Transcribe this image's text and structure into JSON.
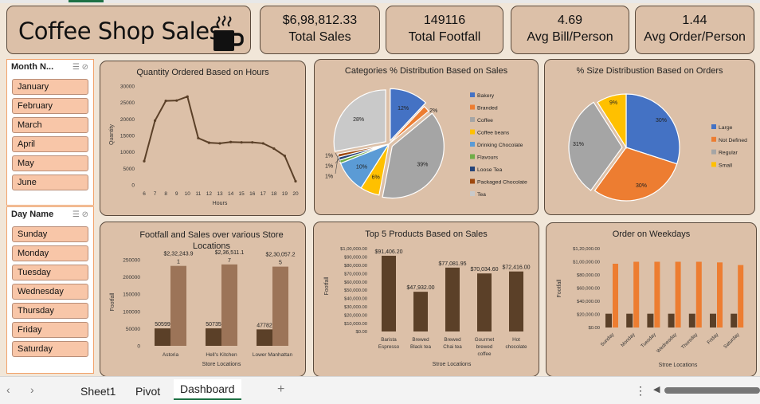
{
  "header": {
    "title": "Coffee Shop Sales",
    "cup_icon": "coffee-cup-icon"
  },
  "kpis": [
    {
      "value": "$6,98,812.33",
      "label": "Total Sales"
    },
    {
      "value": "149116",
      "label": "Total Footfall"
    },
    {
      "value": "4.69",
      "label": "Avg Bill/Person"
    },
    {
      "value": "1.44",
      "label": "Avg Order/Person"
    }
  ],
  "slicers": {
    "month": {
      "title": "Month N...",
      "items": [
        "January",
        "February",
        "March",
        "April",
        "May",
        "June"
      ]
    },
    "day": {
      "title": "Day Name",
      "items": [
        "Sunday",
        "Monday",
        "Tuesday",
        "Wednesday",
        "Thursday",
        "Friday",
        "Saturday"
      ]
    }
  },
  "tabs": {
    "sheet1": "Sheet1",
    "pivot": "Pivot",
    "dashboard": "Dashboard",
    "add": "+"
  },
  "colors": {
    "brown_dark": "#5b4028",
    "brown_light": "#9c7458",
    "orange": "#ed7d31",
    "blue": "#4472c4",
    "grey": "#a5a5a5",
    "gold": "#ffc000"
  },
  "chart_data": [
    {
      "type": "line",
      "title": "Quantity Ordered Based on Hours",
      "xlabel": "Hours",
      "ylabel": "Quantity",
      "x": [
        6,
        7,
        8,
        9,
        10,
        11,
        12,
        13,
        14,
        15,
        16,
        17,
        18,
        19,
        20
      ],
      "y": [
        7200,
        19500,
        25500,
        25600,
        26800,
        14200,
        12800,
        12600,
        13000,
        12900,
        12900,
        12600,
        11000,
        8800,
        1100
      ],
      "yticks": [
        "30000",
        "25000",
        "20000",
        "15000",
        "10000",
        "5000",
        "0"
      ],
      "ylim": [
        0,
        30000
      ]
    },
    {
      "type": "pie",
      "title": "Categories % Distribution Based on Sales",
      "legend": [
        "Bakery",
        "Branded",
        "Coffee",
        "Coffee beans",
        "Drinking Chocolate",
        "Flavours",
        "Loose Tea",
        "Packaged Chocolate",
        "Tea"
      ],
      "labels": [
        "12%",
        "2%",
        "39%",
        "6%",
        "10%",
        "1%",
        "1%",
        "1%",
        "28%"
      ],
      "values": [
        12,
        2,
        39,
        6,
        10,
        1,
        1,
        1,
        28
      ],
      "colors": [
        "#4472c4",
        "#ed7d31",
        "#a5a5a5",
        "#ffc000",
        "#5b9bd5",
        "#70ad47",
        "#264478",
        "#9e480e",
        "#c9c9c9"
      ]
    },
    {
      "type": "pie",
      "title": "% Size Distribustion Based on Orders",
      "legend": [
        "Large",
        "Not Defined",
        "Regular",
        "Small"
      ],
      "labels": [
        "30%",
        "30%",
        "31%",
        "9%"
      ],
      "values": [
        30,
        30,
        31,
        9
      ],
      "colors": [
        "#4472c4",
        "#ed7d31",
        "#a5a5a5",
        "#ffc000"
      ]
    },
    {
      "type": "bar",
      "title": "Footfall and Sales over various Store Locations",
      "xlabel": "Store Locations",
      "ylabel": "Footfall",
      "categories": [
        "Astoria",
        "Hell's Kitchen",
        "Lower Manhattan"
      ],
      "series": [
        {
          "values": [
            50599,
            50735,
            47782
          ],
          "labels": [
            "50599",
            "50735",
            "47782"
          ]
        },
        {
          "values": [
            232243.9,
            236511.17,
            230057.25
          ],
          "labels": [
            "$2,32,243.9\n1",
            "$2,36,511.1\n7",
            "$2,30,057.2\n5"
          ]
        }
      ],
      "yticks": [
        "250000",
        "200000",
        "150000",
        "100000",
        "50000",
        "0"
      ],
      "ylim": [
        0,
        250000
      ]
    },
    {
      "type": "bar",
      "title": "Top 5 Products Based on Sales",
      "xlabel": "Stroe Locations",
      "ylabel": "Footfall",
      "categories": [
        "Barista Espresso",
        "Brewed Black tea",
        "Brewed Chai tea",
        "Gourmet brewed coffee",
        "Hot chocolate"
      ],
      "category_lines": [
        [
          "Barista",
          "Espresso"
        ],
        [
          "Brewed",
          "Black tea"
        ],
        [
          "Brewed",
          "Chai tea"
        ],
        [
          "Gourmet",
          "brewed",
          "coffee"
        ],
        [
          "Hot",
          "chocolate"
        ]
      ],
      "values": [
        91406.2,
        47932.0,
        77081.95,
        70034.6,
        72416.0
      ],
      "labels": [
        "$91,406.20",
        "$47,932.00",
        "$77,081.95",
        "$70,034.60",
        "$72,416.00"
      ],
      "yticks": [
        "$1,00,000.00",
        "$90,000.00",
        "$80,000.00",
        "$70,000.00",
        "$60,000.00",
        "$50,000.00",
        "$40,000.00",
        "$30,000.00",
        "$20,000.00",
        "$10,000.00",
        "$0.00"
      ],
      "ylim": [
        0,
        100000
      ]
    },
    {
      "type": "bar",
      "title": "Order on Weekdays",
      "xlabel": "Stroe Locations",
      "ylabel": "Footfall",
      "categories": [
        "Sunday",
        "Monday",
        "Tuesday",
        "Wednesday",
        "Thursday",
        "Friday",
        "Saturday"
      ],
      "series": [
        {
          "values": [
            21000,
            21000,
            21000,
            21000,
            21000,
            21000,
            21000
          ]
        },
        {
          "values": [
            97000,
            100000,
            100000,
            100000,
            100000,
            99000,
            95000
          ]
        }
      ],
      "yticks": [
        "$1,20,000.00",
        "$1,00,000.00",
        "$80,000.00",
        "$60,000.00",
        "$40,000.00",
        "$20,000.00",
        "$0.00"
      ],
      "ylim": [
        0,
        120000
      ]
    }
  ]
}
